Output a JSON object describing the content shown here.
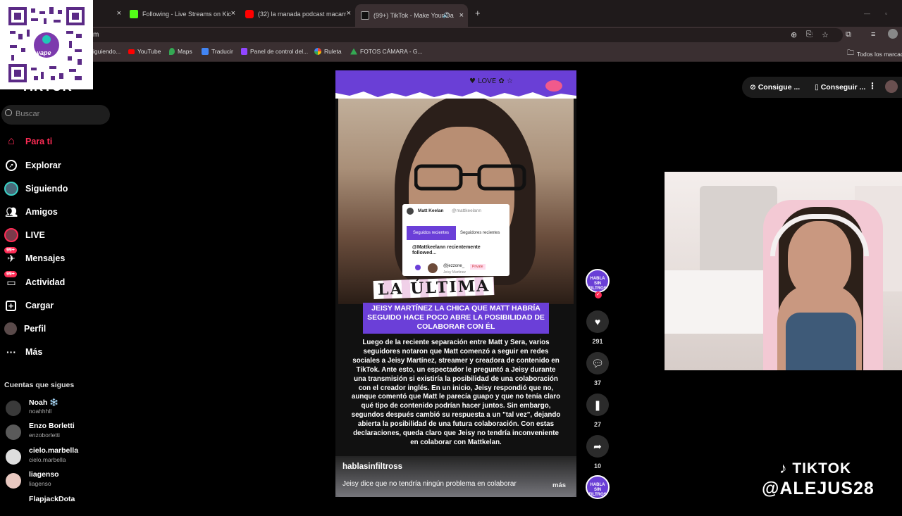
{
  "browser": {
    "tabs": [
      {
        "title": "",
        "favicon_color": "#2b2b2b"
      },
      {
        "title": "Following - Live Streams on Kic",
        "favicon_color": "#53fc18"
      },
      {
        "title": "(32) la manada podcast macarr",
        "favicon_color": "#ff0000"
      },
      {
        "title": "(99+) TikTok - Make Your Da",
        "favicon_color": "#000000"
      }
    ],
    "new_tab": "+",
    "address_fragment": "m",
    "bookmarks": [
      {
        "label": "iguiendo...",
        "color": "#9146ff"
      },
      {
        "label": "YouTube",
        "color": "#ff0000"
      },
      {
        "label": "Maps",
        "color": "#34a853"
      },
      {
        "label": "Traducir",
        "color": "#4285f4"
      },
      {
        "label": "Panel de control del...",
        "color": "#9146ff"
      },
      {
        "label": "Ruleta",
        "color": "#fbbc05"
      },
      {
        "label": "FOTOS CÁMARA - G...",
        "color": "#34a853"
      }
    ],
    "all_bookmarks": "Todos los marcad"
  },
  "qr": {
    "label": "yape"
  },
  "sidebar": {
    "logo": "TIKTOK",
    "search_placeholder": "Buscar",
    "items": [
      {
        "label": "Para ti",
        "icon": "home-icon",
        "active": true
      },
      {
        "label": "Explorar",
        "icon": "compass-icon"
      },
      {
        "label": "Siguiendo",
        "icon": "following-icon"
      },
      {
        "label": "Amigos",
        "icon": "friends-icon"
      },
      {
        "label": "LIVE",
        "icon": "live-icon"
      },
      {
        "label": "Mensajes",
        "icon": "messages-icon",
        "badge": "99+"
      },
      {
        "label": "Actividad",
        "icon": "activity-icon",
        "badge": "99+"
      },
      {
        "label": "Cargar",
        "icon": "upload-icon"
      },
      {
        "label": "Perfil",
        "icon": "profile-icon"
      },
      {
        "label": "Más",
        "icon": "more-icon"
      }
    ],
    "following_title": "Cuentas que sigues",
    "accounts": [
      {
        "name": "Noah ❄️",
        "handle": "noahhhll"
      },
      {
        "name": "Enzo Borletti",
        "handle": "enzoborletti"
      },
      {
        "name": "cielo.marbella",
        "handle": "cielo.marbella"
      },
      {
        "name": "liagenso",
        "handle": "liagenso"
      },
      {
        "name": "FlapjackDota",
        "handle": ""
      }
    ]
  },
  "video": {
    "overlay_title": "LA ÚLTIMA",
    "card": {
      "user": "Matt Keelan",
      "handle": "@mattkeelann",
      "tab_active": "Seguidos recientes",
      "tab_inactive": "Seguidores recientes",
      "text": "@Mattkeelann recientemente followed...",
      "follow_user": "@jezzone_",
      "follow_sub": "Jeisy Martinez",
      "follow_badge": "Private"
    },
    "headline": "JEISY MARTÍNEZ LA CHICA QUE MATT HABRÍA SEGUIDO HACE POCO ABRE LA POSIBILIDAD DE COLABORAR CON ÉL",
    "body": "Luego de la reciente separación entre Matt y Sera, varios seguidores notaron que Matt comenzó a seguir en redes sociales a Jeisy Martínez, streamer y creadora de contenido en TikTok. Ante esto, un espectador le preguntó a Jeisy durante una transmisión si existiría la posibilidad de una colaboración con el creador inglés. En un inicio, Jeisy respondió que no, aunque comentó que Matt le parecía guapo y que no tenía claro qué tipo de contenido podrían hacer juntos. Sin embargo, segundos después cambió su respuesta a un \"tal vez\", dejando abierta la posibilidad de una futura colaboración. Con estas declaraciones, queda claro que Jeisy no tendría inconveniente en colaborar con Mattkelan.",
    "author": "hablasinfiltross",
    "caption": "Jeisy dice que no tendría ningún problema en colaborar",
    "more": "más",
    "avatar_text": "HABLA SIN FILTROS"
  },
  "actions": {
    "likes": "291",
    "comments": "37",
    "saves": "27",
    "shares": "10"
  },
  "topright": {
    "coins": "Consigue ...",
    "app": "Conseguir ..."
  },
  "watermark": {
    "line1": "TIKTOK",
    "line2": "@ALEJUS28"
  }
}
